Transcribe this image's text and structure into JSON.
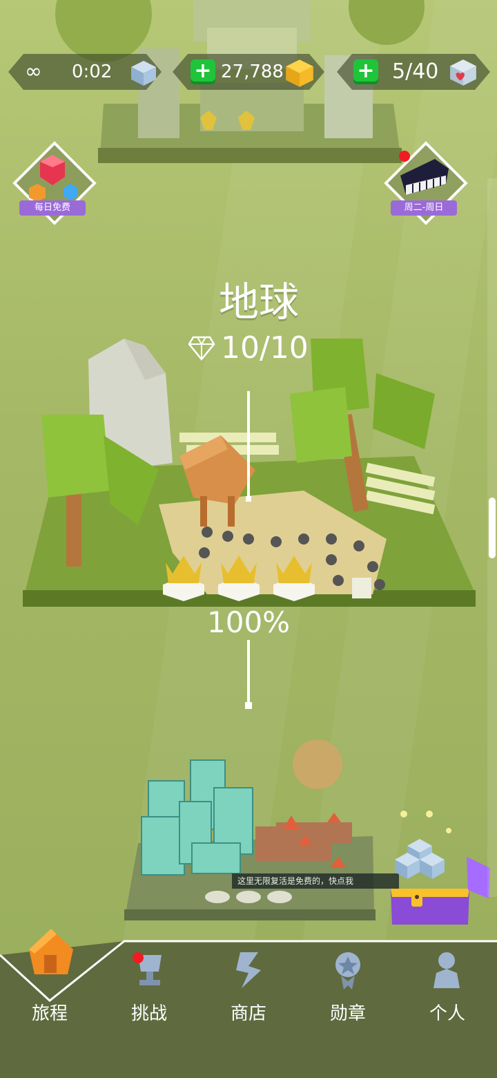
{
  "hud": {
    "timer": "0:02",
    "coins": "27,788",
    "lives": "5/40"
  },
  "badges": {
    "left_label": "每日免费",
    "right_label": "周二-周日"
  },
  "level": {
    "title": "地球",
    "gems": "10/10",
    "progress": "100%",
    "crowns": 3
  },
  "toast": "这里无限复活是免费的，快点我",
  "nav": {
    "items": [
      {
        "label": "旅程"
      },
      {
        "label": "挑战"
      },
      {
        "label": "商店"
      },
      {
        "label": "勋章"
      },
      {
        "label": "个人"
      }
    ]
  },
  "colors": {
    "accent_green": "#1fc43a",
    "badge_purple": "#9b6ad9",
    "alert_red": "#ef1c23",
    "nav_bg": "#5f6a3f"
  }
}
